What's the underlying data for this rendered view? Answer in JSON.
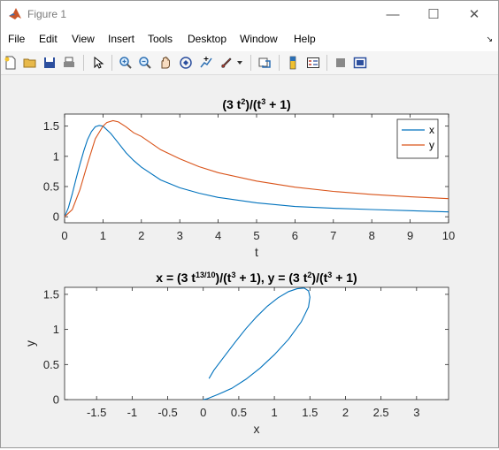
{
  "window": {
    "title": "Figure 1",
    "controls": {
      "minimize": "—",
      "maximize": "☐",
      "close": "✕"
    }
  },
  "menu": {
    "items": [
      "File",
      "Edit",
      "View",
      "Insert",
      "Tools",
      "Desktop",
      "Window",
      "Help"
    ],
    "dock_arrow": "↘"
  },
  "toolbar": {
    "icons": [
      "new-figure-icon",
      "open-icon",
      "save-icon",
      "print-icon",
      "pointer-icon",
      "zoom-in-icon",
      "zoom-out-icon",
      "pan-icon",
      "rotate-3d-icon",
      "data-cursor-icon",
      "brush-icon",
      "link-plot-icon",
      "colorbar-icon",
      "legend-icon",
      "hide-plot-tools-icon",
      "show-plot-tools-icon"
    ]
  },
  "colors": {
    "series_x": "#0072BD",
    "series_y": "#D95319"
  },
  "chart_data": [
    {
      "type": "line",
      "title": "(3 t²)/(t³ + 1)",
      "xlabel": "t",
      "ylabel": "",
      "xlim": [
        0,
        10
      ],
      "ylim": [
        -0.1,
        1.7
      ],
      "xticks": [
        "0",
        "1",
        "2",
        "3",
        "4",
        "5",
        "6",
        "7",
        "8",
        "9",
        "10"
      ],
      "yticks": [
        "0",
        "0.5",
        "1",
        "1.5"
      ],
      "legend_position": "top-right",
      "series": [
        {
          "name": "x",
          "x": [
            0,
            0.1,
            0.2,
            0.3,
            0.4,
            0.5,
            0.6,
            0.7,
            0.8,
            0.9,
            1.0,
            1.2,
            1.4,
            1.6,
            1.8,
            2.0,
            2.5,
            3.0,
            3.5,
            4.0,
            5.0,
            6.0,
            7.0,
            8.0,
            9.0,
            10.0
          ],
          "y": [
            0,
            0.15,
            0.38,
            0.63,
            0.87,
            1.09,
            1.28,
            1.41,
            1.49,
            1.51,
            1.5,
            1.38,
            1.22,
            1.06,
            0.93,
            0.82,
            0.61,
            0.48,
            0.39,
            0.32,
            0.23,
            0.17,
            0.14,
            0.12,
            0.1,
            0.08
          ]
        },
        {
          "name": "y",
          "x": [
            0,
            0.2,
            0.4,
            0.6,
            0.8,
            1.0,
            1.1,
            1.26,
            1.4,
            1.6,
            1.8,
            2.0,
            2.5,
            3.0,
            3.5,
            4.0,
            5.0,
            6.0,
            7.0,
            8.0,
            9.0,
            10.0
          ],
          "y": [
            0,
            0.12,
            0.45,
            0.88,
            1.29,
            1.5,
            1.56,
            1.59,
            1.57,
            1.49,
            1.39,
            1.33,
            1.11,
            0.96,
            0.83,
            0.73,
            0.59,
            0.49,
            0.42,
            0.37,
            0.33,
            0.3
          ]
        }
      ]
    },
    {
      "type": "line",
      "title": "x = (3 t^(13/10))/(t³ + 1), y = (3 t²)/(t³ + 1)",
      "xlabel": "x",
      "ylabel": "y",
      "xlim": [
        -1.95,
        3.45
      ],
      "ylim": [
        0,
        1.6
      ],
      "xticks": [
        "-1.5",
        "-1",
        "-0.5",
        "0",
        "0.5",
        "1",
        "1.5",
        "2",
        "2.5",
        "3"
      ],
      "yticks": [
        "0",
        "0.5",
        "1",
        "1.5"
      ],
      "series": [
        {
          "x": [
            0.08,
            0.15,
            0.3,
            0.45,
            0.6,
            0.75,
            0.9,
            1.05,
            1.2,
            1.32,
            1.42,
            1.48,
            1.5,
            1.48,
            1.38,
            1.2,
            1.0,
            0.8,
            0.6,
            0.4,
            0.2,
            0.05,
            0
          ],
          "y": [
            0.3,
            0.42,
            0.62,
            0.82,
            1.01,
            1.18,
            1.33,
            1.45,
            1.54,
            1.58,
            1.59,
            1.55,
            1.46,
            1.32,
            1.11,
            0.86,
            0.64,
            0.45,
            0.29,
            0.16,
            0.07,
            0.01,
            0
          ]
        }
      ]
    }
  ]
}
